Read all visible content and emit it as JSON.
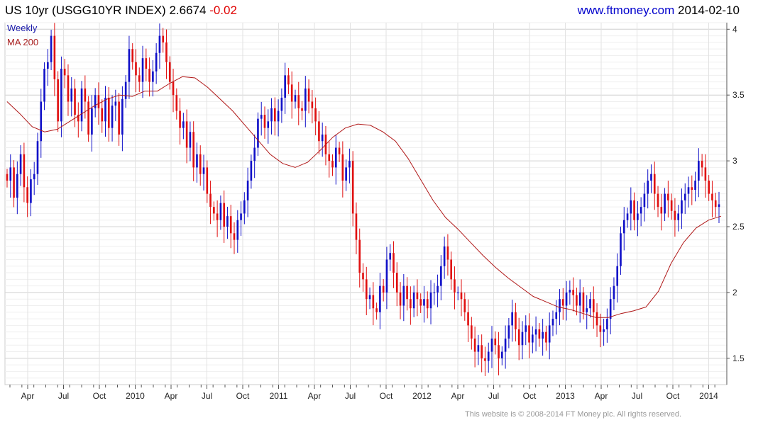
{
  "header": {
    "title": "US 10yr (USGG10YR INDEX) 2.6674",
    "change": "-0.02",
    "site": "www.ftmoney.com",
    "date": "2014-02-10"
  },
  "footer": {
    "copyright": "This website is © 2008-2014 FT Money plc. All rights reserved."
  },
  "colors": {
    "up": "#1010c8",
    "down": "#e01010",
    "ma": "#b01818",
    "grid": "#d4d4d4",
    "axis": "#555555"
  },
  "chart_data": {
    "type": "candlestick",
    "title": "US 10yr (USGG10YR INDEX) 2.6674",
    "period": "Weekly",
    "legend": [
      "Weekly",
      "MA 200"
    ],
    "legend_placement": "top-left",
    "y_axis_side": "right",
    "ylim": [
      1.3,
      4.05
    ],
    "y_ticks": [
      1.5,
      2,
      2.5,
      3,
      3.5,
      4
    ],
    "y_tick_labels": [
      "1.5",
      "2",
      "2.5",
      "3",
      "3.5",
      "4"
    ],
    "x_tick_labels": [
      "Apr",
      "Jul",
      "Oct",
      "2010",
      "Apr",
      "Jul",
      "Oct",
      "2011",
      "Apr",
      "Jul",
      "Oct",
      "2012",
      "Apr",
      "Jul",
      "Oct",
      "2013",
      "Apr",
      "Jul",
      "Oct",
      "2014"
    ],
    "grid": true,
    "close_weekly": [
      2.85,
      2.95,
      2.72,
      2.9,
      3.05,
      2.8,
      2.68,
      2.86,
      2.9,
      3.15,
      3.45,
      3.7,
      3.75,
      3.95,
      3.62,
      3.3,
      3.7,
      3.65,
      3.45,
      3.55,
      3.35,
      3.3,
      3.55,
      3.45,
      3.2,
      3.4,
      3.5,
      3.4,
      3.3,
      3.48,
      3.25,
      3.42,
      3.45,
      3.2,
      3.47,
      3.6,
      3.85,
      3.75,
      3.65,
      3.6,
      3.78,
      3.7,
      3.6,
      3.68,
      3.82,
      3.95,
      3.9,
      3.75,
      3.6,
      3.5,
      3.38,
      3.25,
      3.3,
      3.1,
      3.22,
      2.95,
      3.05,
      2.9,
      2.95,
      2.75,
      2.65,
      2.6,
      2.55,
      2.68,
      2.5,
      2.58,
      2.45,
      2.4,
      2.55,
      2.6,
      2.7,
      2.85,
      3.0,
      3.1,
      3.32,
      3.35,
      3.25,
      3.3,
      3.4,
      3.3,
      3.38,
      3.48,
      3.65,
      3.58,
      3.45,
      3.5,
      3.4,
      3.38,
      3.55,
      3.45,
      3.4,
      3.3,
      3.15,
      3.2,
      3.05,
      3.0,
      2.95,
      3.1,
      3.05,
      2.85,
      2.95,
      3.0,
      2.6,
      2.4,
      2.15,
      2.1,
      1.95,
      1.98,
      1.88,
      1.85,
      2.05,
      2.0,
      2.25,
      2.3,
      2.15,
      2.0,
      1.9,
      2.05,
      1.95,
      1.88,
      2.0,
      1.95,
      1.9,
      1.95,
      1.88,
      2.0,
      2.0,
      2.05,
      2.2,
      2.35,
      2.25,
      2.1,
      2.0,
      2.0,
      1.95,
      1.85,
      1.75,
      1.65,
      1.55,
      1.6,
      1.5,
      1.48,
      1.55,
      1.65,
      1.6,
      1.5,
      1.55,
      1.65,
      1.75,
      1.85,
      1.72,
      1.6,
      1.7,
      1.75,
      1.62,
      1.68,
      1.72,
      1.65,
      1.7,
      1.62,
      1.75,
      1.8,
      1.85,
      1.95,
      1.9,
      2.0,
      2.02,
      1.98,
      1.9,
      2.0,
      1.85,
      1.88,
      1.95,
      1.85,
      1.75,
      1.7,
      1.72,
      1.8,
      1.95,
      2.05,
      2.2,
      2.45,
      2.55,
      2.6,
      2.7,
      2.55,
      2.6,
      2.65,
      2.75,
      2.85,
      2.9,
      2.75,
      2.65,
      2.6,
      2.75,
      2.7,
      2.62,
      2.55,
      2.6,
      2.7,
      2.75,
      2.8,
      2.78,
      2.85,
      3.0,
      2.95,
      2.85,
      2.75,
      2.7,
      2.65,
      2.67
    ],
    "ma200_weekly": [
      3.45,
      3.36,
      3.26,
      3.22,
      3.24,
      3.3,
      3.36,
      3.42,
      3.47,
      3.5,
      3.49,
      3.53,
      3.53,
      3.59,
      3.64,
      3.63,
      3.56,
      3.47,
      3.38,
      3.27,
      3.16,
      3.05,
      2.98,
      2.95,
      2.99,
      3.08,
      3.18,
      3.25,
      3.28,
      3.27,
      3.22,
      3.15,
      3.02,
      2.86,
      2.7,
      2.57,
      2.48,
      2.38,
      2.28,
      2.19,
      2.11,
      2.04,
      1.97,
      1.93,
      1.89,
      1.87,
      1.84,
      1.81,
      1.81,
      1.84,
      1.86,
      1.89,
      2.01,
      2.22,
      2.38,
      2.49,
      2.55,
      2.58
    ]
  }
}
